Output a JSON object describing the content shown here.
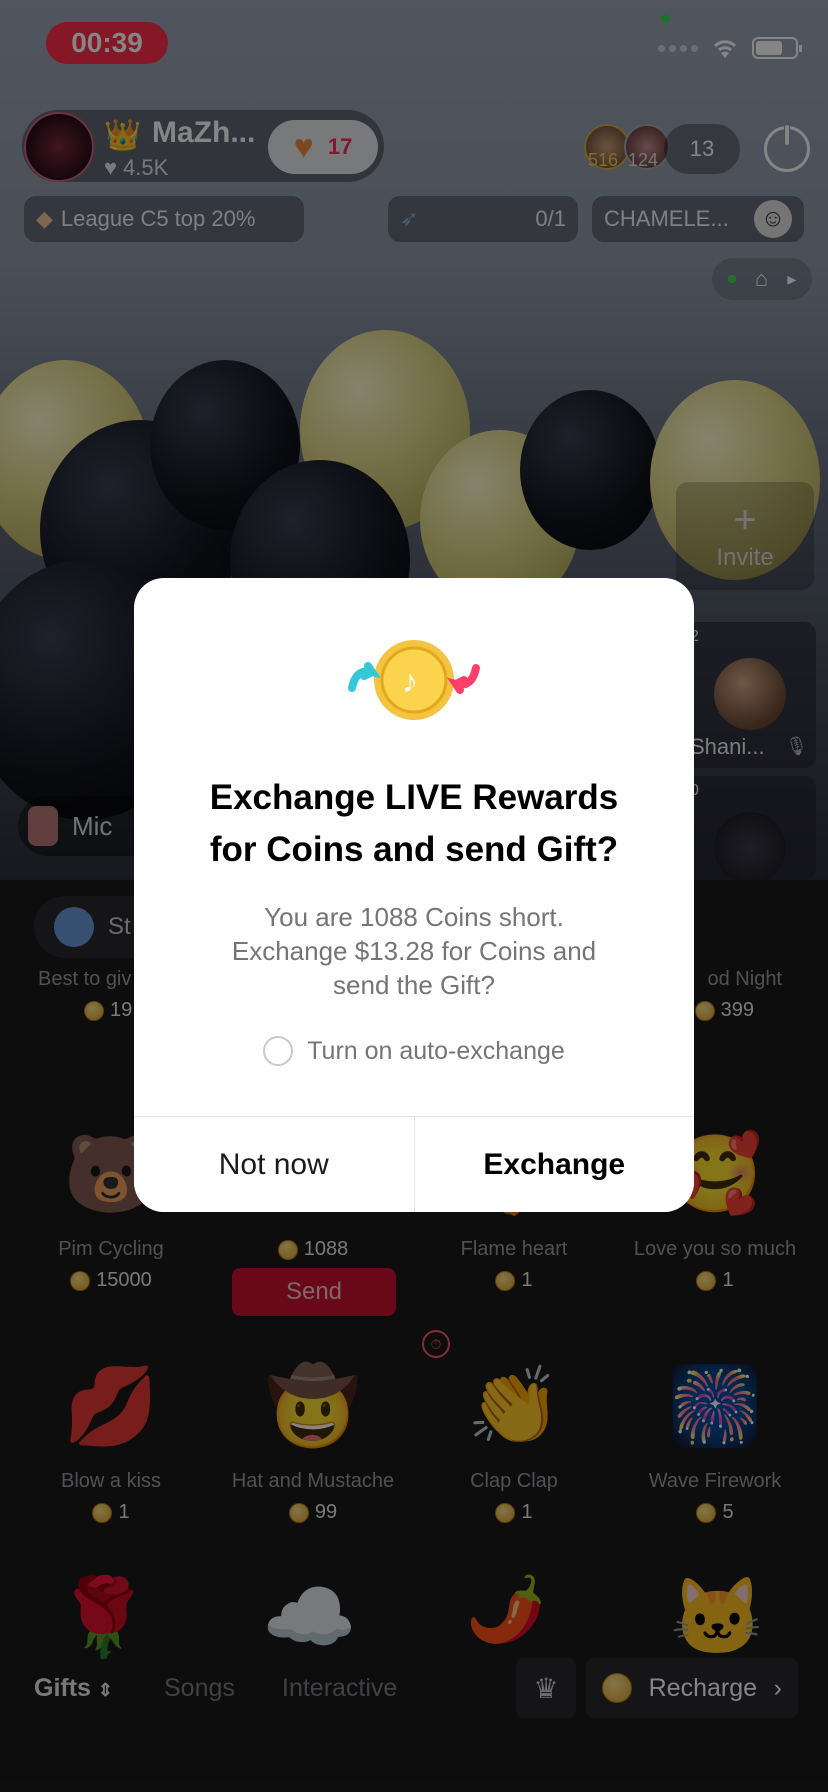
{
  "status_bar": {
    "time": "00:39"
  },
  "host": {
    "name": "MaZh...",
    "likes": "4.5K",
    "follow_count": "17"
  },
  "viewers": {
    "badge_1": "516",
    "badge_2": "124",
    "count": "13"
  },
  "chips": {
    "league": "League C5 top 20%",
    "quest_progress": "0/1",
    "chameleon": "CHAMELE..."
  },
  "guests": {
    "invite_label": "Invite",
    "guest_1_num": "2",
    "guest_1_name": "Shani...",
    "guest_2_num": "0",
    "mic_label": "Mic"
  },
  "streak_label": "St",
  "gifts": [
    {
      "name": "Best to giv",
      "price": "19",
      "icon": "🌊"
    },
    {
      "name": "",
      "price": "",
      "icon": ""
    },
    {
      "name": "",
      "price": "",
      "icon": ""
    },
    {
      "name": "od Night",
      "price": "399",
      "icon": "🌙"
    },
    {
      "name": "Pim Cycling",
      "price": "15000",
      "icon": "🐻"
    },
    {
      "name": "",
      "price": "1088",
      "icon": ""
    },
    {
      "name": "Flame heart",
      "price": "1",
      "icon": "❤️‍🔥"
    },
    {
      "name": "Love you so much",
      "price": "1",
      "icon": "🥰"
    },
    {
      "name": "Blow a kiss",
      "price": "1",
      "icon": "💋"
    },
    {
      "name": "Hat and Mustache",
      "price": "99",
      "icon": "🤠"
    },
    {
      "name": "Clap Clap",
      "price": "1",
      "icon": "👏"
    },
    {
      "name": "Wave Firework",
      "price": "5",
      "icon": "🎆"
    }
  ],
  "send_label": "Send",
  "tabs": {
    "gifts": "Gifts",
    "songs": "Songs",
    "interactive": "Interactive",
    "recharge": "Recharge"
  },
  "modal": {
    "title_line_1": "Exchange LIVE Rewards",
    "title_line_2": "for Coins and send Gift?",
    "body_line_1": "You are 1088 Coins short.",
    "body_line_2": "Exchange $13.28 for Coins and",
    "body_line_3": "send the Gift?",
    "auto_exchange_label": "Turn on auto-exchange",
    "not_now_label": "Not now",
    "exchange_label": "Exchange"
  },
  "colors": {
    "accent_red": "#ff2d4b",
    "send_red": "#c8102e",
    "coin_gold": "#f5c342"
  },
  "icons": [
    "wifi-icon",
    "battery-icon",
    "power-icon",
    "crown-icon",
    "coin-icon",
    "heart-icon",
    "home-icon",
    "mic-off-icon",
    "timer-icon",
    "chevron-right-icon",
    "sort-icon"
  ]
}
